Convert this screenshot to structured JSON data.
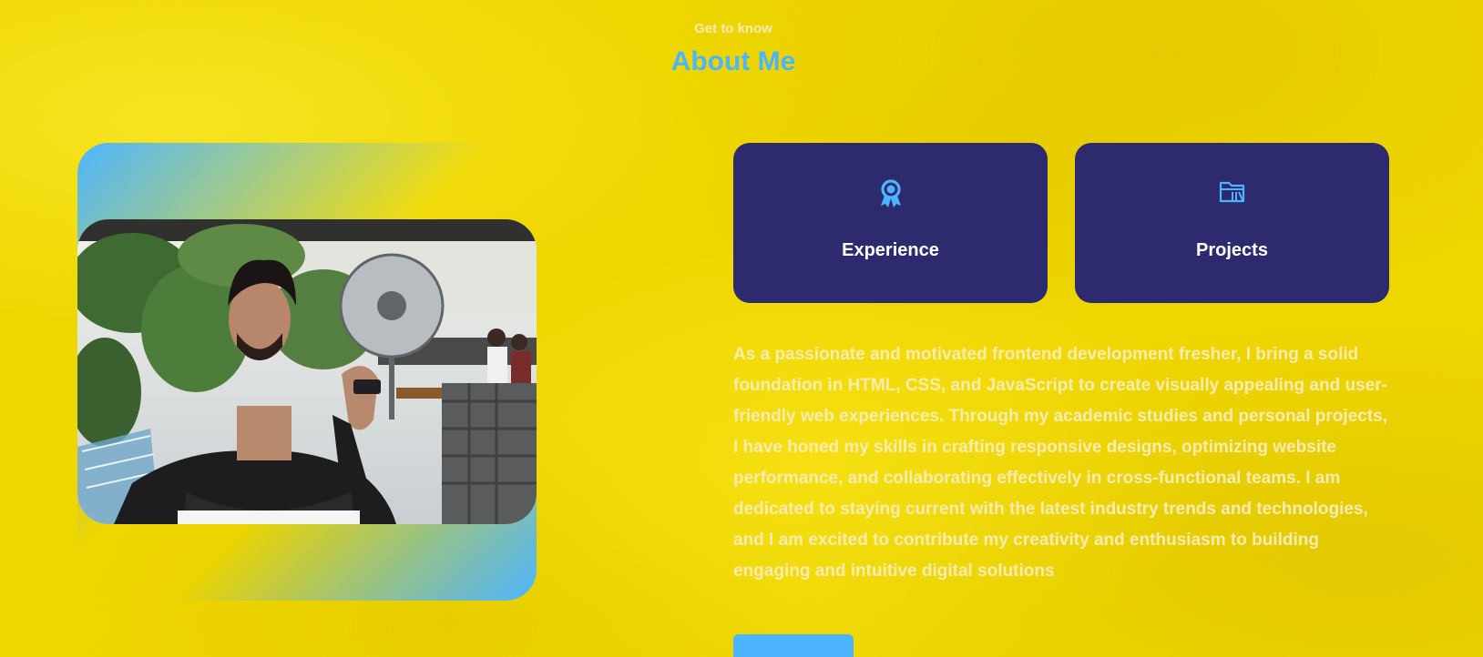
{
  "header": {
    "subtitle": "Get to know",
    "title": "About Me"
  },
  "photo": {
    "alt": "Portrait photo of the developer sitting at a cafe"
  },
  "cards": [
    {
      "label": "Experience",
      "icon": "award-icon"
    },
    {
      "label": "Projects",
      "icon": "folder-icon"
    }
  ],
  "about": {
    "text": "As a passionate and motivated frontend development fresher, I bring a solid foundation in HTML, CSS, and JavaScript to create visually appealing and user-friendly web experiences. Through my academic studies and personal projects, I have honed my skills in crafting responsive designs, optimizing website performance, and collaborating effectively in cross-functional teams. I am dedicated to staying current with the latest industry trends and technologies, and I am excited to contribute my creativity and enthusiasm to building engaging and intuitive digital solutions"
  },
  "colors": {
    "background": "#eed600",
    "accent": "#4db5ff",
    "card": "#2e2a6e",
    "muted_text": "#f7ecb0"
  }
}
